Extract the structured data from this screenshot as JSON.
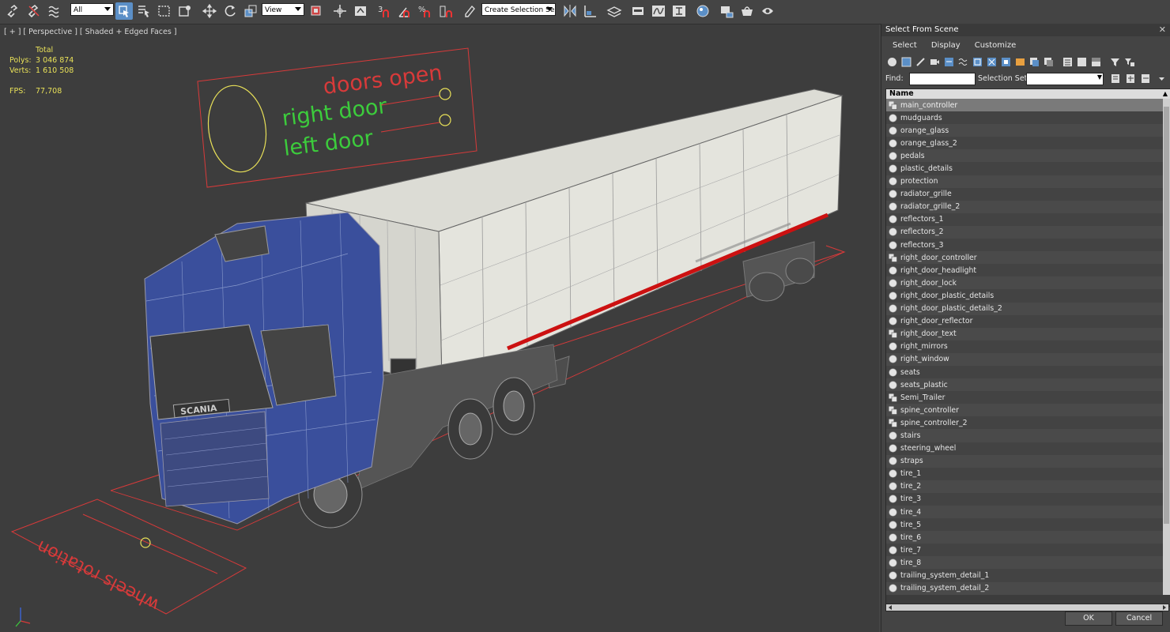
{
  "toolbar": {
    "filter_combo": "All",
    "refcoord_combo": "View",
    "selection_set_combo": "Create Selection Se",
    "icons": [
      "link-icon",
      "unlink-icon",
      "bind-spacewarp-icon",
      "select-object-icon",
      "select-by-name-icon",
      "rect-region-icon",
      "window-crossing-icon",
      "move-icon",
      "rotate-icon",
      "scale-icon",
      "pivot-icon",
      "snap-icon",
      "angle-snap-icon",
      "percent-snap-icon",
      "spinner-snap-icon",
      "edit-named-sets-icon",
      "mirror-icon",
      "align-icon",
      "layer-icon",
      "graphite-icon",
      "curve-editor-icon",
      "schematic-icon",
      "material-editor-icon",
      "render-setup-icon",
      "rendered-frame-icon",
      "render-icon"
    ],
    "snap_label": "3",
    "snap_label_2": "%"
  },
  "viewport": {
    "label": "[ + ] [ Perspective ] [ Shaded + Edged Faces ]",
    "stats": {
      "header": "Total",
      "polys_label": "Polys:",
      "polys_value": "3 046 874",
      "verts_label": "Verts:",
      "verts_value": "1 610 508",
      "fps_label": "FPS:",
      "fps_value": "77,708"
    },
    "scene_labels": {
      "doors_open": "doors open",
      "right_door": "right door",
      "left_door": "left door",
      "wheels_rotation": "wheels rotation",
      "cab_badge": "SCANIA"
    },
    "colors": {
      "red_text": "#d83a3a",
      "green_text": "#3ccc3c",
      "yellow_circle": "#e8e058",
      "truck_blue": "#3a4f9c",
      "trailer_white": "#e3e3dc",
      "stripe_red": "#cc1111"
    }
  },
  "dialog": {
    "title": "Select From Scene",
    "close_icon": "close-icon",
    "menu": [
      "Select",
      "Display",
      "Customize"
    ],
    "find_label": "Find:",
    "find_value": "",
    "selection_set_label": "Selection Set:",
    "column_header": "Name",
    "items": [
      {
        "name": "main_controller",
        "type": "helper",
        "selected": true
      },
      {
        "name": "mudguards",
        "type": "geometry"
      },
      {
        "name": "orange_glass",
        "type": "geometry"
      },
      {
        "name": "orange_glass_2",
        "type": "geometry"
      },
      {
        "name": "pedals",
        "type": "geometry"
      },
      {
        "name": "plastic_details",
        "type": "geometry"
      },
      {
        "name": "protection",
        "type": "geometry"
      },
      {
        "name": "radiator_grille",
        "type": "geometry"
      },
      {
        "name": "radiator_grille_2",
        "type": "geometry"
      },
      {
        "name": "reflectors_1",
        "type": "geometry"
      },
      {
        "name": "reflectors_2",
        "type": "geometry"
      },
      {
        "name": "reflectors_3",
        "type": "geometry"
      },
      {
        "name": "right_door_controller",
        "type": "helper"
      },
      {
        "name": "right_door_headlight",
        "type": "geometry"
      },
      {
        "name": "right_door_lock",
        "type": "geometry"
      },
      {
        "name": "right_door_plastic_details",
        "type": "geometry"
      },
      {
        "name": "right_door_plastic_details_2",
        "type": "geometry"
      },
      {
        "name": "right_door_reflector",
        "type": "geometry"
      },
      {
        "name": "right_door_text",
        "type": "helper"
      },
      {
        "name": "right_mirrors",
        "type": "geometry"
      },
      {
        "name": "right_window",
        "type": "geometry"
      },
      {
        "name": "seats",
        "type": "geometry"
      },
      {
        "name": "seats_plastic",
        "type": "geometry"
      },
      {
        "name": "Semi_Trailer",
        "type": "helper"
      },
      {
        "name": "spine_controller",
        "type": "helper"
      },
      {
        "name": "spine_controller_2",
        "type": "helper"
      },
      {
        "name": "stairs",
        "type": "geometry"
      },
      {
        "name": "steering_wheel",
        "type": "geometry"
      },
      {
        "name": "straps",
        "type": "geometry"
      },
      {
        "name": "tire_1",
        "type": "geometry"
      },
      {
        "name": "tire_2",
        "type": "geometry"
      },
      {
        "name": "tire_3",
        "type": "geometry"
      },
      {
        "name": "tire_4",
        "type": "geometry"
      },
      {
        "name": "tire_5",
        "type": "geometry"
      },
      {
        "name": "tire_6",
        "type": "geometry"
      },
      {
        "name": "tire_7",
        "type": "geometry"
      },
      {
        "name": "tire_8",
        "type": "geometry"
      },
      {
        "name": "trailing_system_detail_1",
        "type": "geometry"
      },
      {
        "name": "trailing_system_detail_2",
        "type": "geometry"
      }
    ],
    "ok_label": "OK",
    "cancel_label": "Cancel"
  }
}
